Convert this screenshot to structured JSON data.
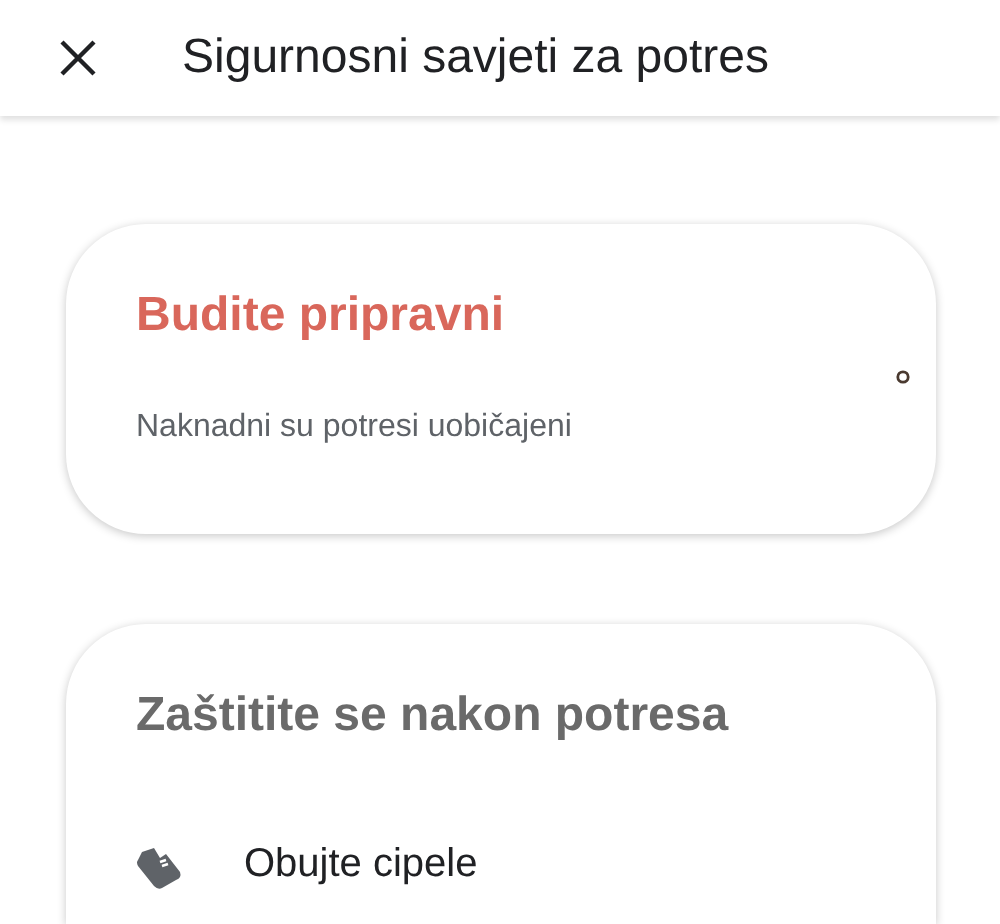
{
  "app_bar": {
    "title": "Sigurnosni savjeti za potres"
  },
  "cards": [
    {
      "title": "Budite pripravni",
      "subtitle": "Naknadni su potresi uobičajeni",
      "kind": "alert"
    },
    {
      "title": "Zaštitite se nakon potresa",
      "kind": "tips",
      "items": [
        {
          "title": "Obujte cipele"
        }
      ]
    }
  ]
}
